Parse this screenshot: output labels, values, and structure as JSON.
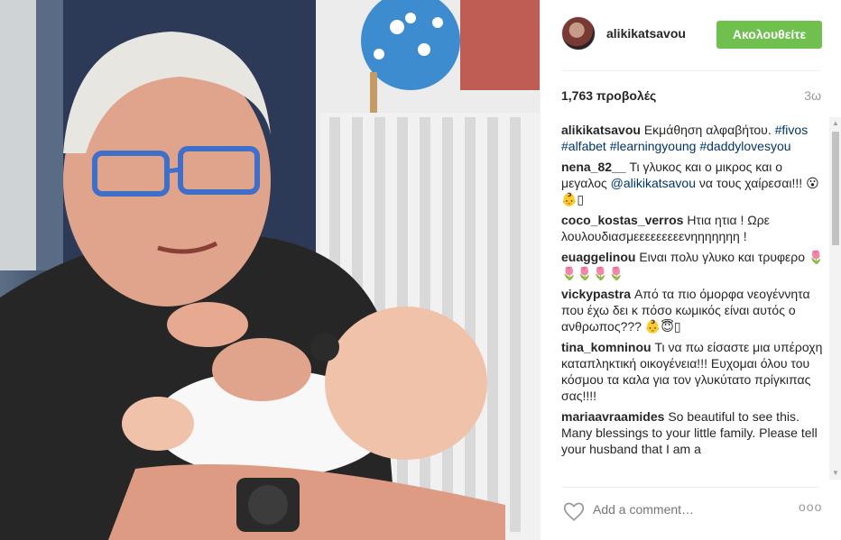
{
  "post": {
    "username": "alikikatsavou",
    "follow_label": "Ακολουθείτε",
    "views": "1,763 προβολές",
    "time": "3ω"
  },
  "comments": [
    {
      "user": "alikikatsavou",
      "text": "Εκμάθηση αλφαβήτου.",
      "tags": "#fivos #alfabet #learningyoung #daddylovesyou"
    },
    {
      "user": "nena_82__",
      "text": "Τι γλυκος και ο μικρος και ο μεγαλος ",
      "mention": "@alikikatsavou",
      "text2": " να τους χαίρεσαι!!! 😮👶▯"
    },
    {
      "user": "coco_kostas_verros",
      "text": "Ητια ητια ! Ωρε λουλουδιασμεεεεεεεεενηηηηηηη !"
    },
    {
      "user": "euaggelinou",
      "text": "Ειναι πολυ γλυκο και τρυφερο 🌷🌷🌷🌷🌷"
    },
    {
      "user": "vickypastra",
      "text": "Από τα πιο όμορφα νεογέννητα που έχω δει κ πόσο κωμικός είναι αυτός ο ανθρωπος??? 👶😇▯"
    },
    {
      "user": "tina_komninou",
      "text": "Τι να πω είσαστε μια υπέροχη καταπληκτική οικογένεια!!! Ευχομαι όλου του κόσμου τα καλα για τον γλυκύτατο πρίγκιπας σας!!!!"
    },
    {
      "user": "mariaavraamides",
      "text": "So beautiful to see this. Many blessings to your little family. Please tell your husband that I am a"
    }
  ],
  "footer": {
    "comment_placeholder": "Add a comment…",
    "more_label": "ooo"
  },
  "icons": {
    "heart": "heart-icon",
    "more": "more-options-icon",
    "scroll_up": "scroll-up-arrow-icon",
    "scroll_down": "scroll-down-arrow-icon"
  },
  "colors": {
    "follow_button": "#70c050",
    "hashtag": "#003569",
    "muted": "#999999"
  }
}
